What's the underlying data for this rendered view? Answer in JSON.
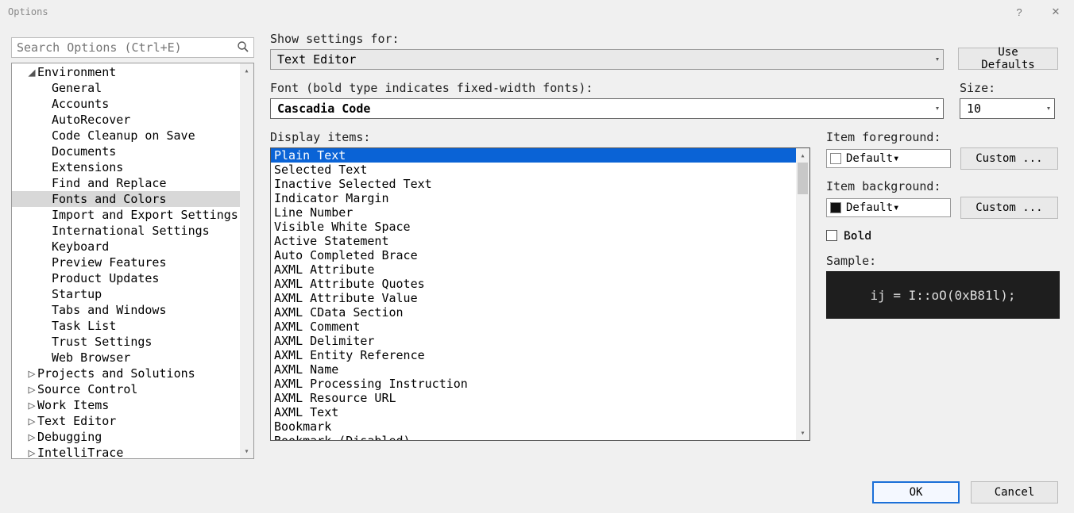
{
  "window": {
    "title": "Options"
  },
  "search": {
    "placeholder": "Search Options (Ctrl+E)"
  },
  "tree": {
    "environment": "Environment",
    "env_children": [
      "General",
      "Accounts",
      "AutoRecover",
      "Code Cleanup on Save",
      "Documents",
      "Extensions",
      "Find and Replace",
      "Fonts and Colors",
      "Import and Export Settings",
      "International Settings",
      "Keyboard",
      "Preview Features",
      "Product Updates",
      "Startup",
      "Tabs and Windows",
      "Task List",
      "Trust Settings",
      "Web Browser"
    ],
    "selected_child": "Fonts and Colors",
    "roots": [
      "Projects and Solutions",
      "Source Control",
      "Work Items",
      "Text Editor",
      "Debugging",
      "IntelliTrace"
    ]
  },
  "settings": {
    "show_label": "Show settings for:",
    "show_value": "Text Editor",
    "use_defaults": "Use Defaults",
    "font_label": "Font (bold type indicates fixed-width fonts):",
    "font_value": "Cascadia Code",
    "size_label": "Size:",
    "size_value": "10",
    "display_label": "Display items:",
    "display_items": [
      "Plain Text",
      "Selected Text",
      "Inactive Selected Text",
      "Indicator Margin",
      "Line Number",
      "Visible White Space",
      "Active Statement",
      "Auto Completed Brace",
      "AXML Attribute",
      "AXML Attribute Quotes",
      "AXML Attribute Value",
      "AXML CData Section",
      "AXML Comment",
      "AXML Delimiter",
      "AXML Entity Reference",
      "AXML Name",
      "AXML Processing Instruction",
      "AXML Resource URL",
      "AXML Text",
      "Bookmark",
      "Bookmark (Disabled)"
    ],
    "display_selected": "Plain Text",
    "fg_label": "Item foreground:",
    "fg_value": "Default",
    "fg_custom": "Custom ...",
    "bg_label": "Item background:",
    "bg_value": "Default",
    "bg_custom": "Custom ...",
    "bold_label": "Bold",
    "sample_label": "Sample:",
    "sample_text": "ij = I::oO(0xB81l);"
  },
  "buttons": {
    "ok": "OK",
    "cancel": "Cancel"
  }
}
